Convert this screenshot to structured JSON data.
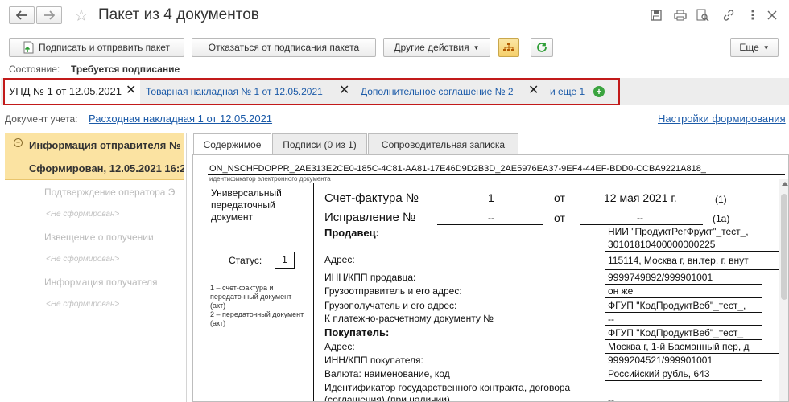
{
  "window": {
    "title": "Пакет из 4 документов"
  },
  "toolbar": {
    "sign_send": "Подписать и отправить пакет",
    "refuse": "Отказаться от подписания пакета",
    "other_actions": "Другие действия",
    "more": "Еще"
  },
  "status": {
    "label": "Состояние:",
    "value": "Требуется подписание"
  },
  "doc_tabs": [
    {
      "label": "УПД № 1 от 12.05.2021"
    },
    {
      "label": "Товарная накладная № 1 от 12.05.2021"
    },
    {
      "label": "Дополнительное соглашение № 2"
    }
  ],
  "doc_tabs_more": "и еще 1",
  "account_doc": {
    "label": "Документ учета:",
    "link": "Расходная накладная 1 от 12.05.2021"
  },
  "settings_link": "Настройки формирования",
  "left_panel": {
    "item1_title": "Информация отправителя №",
    "item1_status": "Сформирован, 12.05.2021 16:2",
    "item2": "Подтверждение оператора Э",
    "item2_status": "<Не сформирован>",
    "item3": "Извещение о получении",
    "item3_status": "<Не сформирован>",
    "item4": "Информация получателя",
    "item4_status": "<Не сформирован>"
  },
  "content_tabs": [
    "Содержимое",
    "Подписи (0 из 1)",
    "Сопроводительная записка"
  ],
  "document": {
    "file_id": "ON_NSCHFDOPPR_2AE313E2CE0-185C-4C81-AA81-17E46D9D2B3D_2AE5976EA37-9EF4-44EF-BDD0-CCBA9221A818_",
    "file_id_caption": "идентификатор электронного документа",
    "doc_type": "Универсальный передаточный документ",
    "status_label": "Статус:",
    "status_value": "1",
    "status_note": "1 – счет-фактура и передаточный документ (акт)\n2 – передаточный документ (акт)",
    "invoice_label": "Счет-фактура №",
    "invoice_number": "1",
    "from": "от",
    "invoice_date": "12 мая 2021 г.",
    "mark1": "(1)",
    "correction_label": "Исправление №",
    "correction_number": "--",
    "correction_date": "--",
    "mark1a": "(1а)",
    "seller_label": "Продавец:",
    "seller_value": "НИИ \"ПродуктРегФрукт\"_тест_,",
    "seller_value2": "30101810400000000225",
    "address_label": "Адрес:",
    "address_value": "115114, Москва г, вн.тер. г. внут",
    "inn_seller_label": "ИНН/КПП продавца:",
    "inn_seller_value": "9999749892/999901001",
    "shipper_label": "Грузоотправитель и его адрес:",
    "shipper_value": "он же",
    "consignee_label": "Грузополучатель и его адрес:",
    "consignee_value": "ФГУП \"КодПродуктВеб\"_тест_,",
    "payment_label": "К платежно-расчетному документу №",
    "payment_value": "--",
    "buyer_label": "Покупатель:",
    "buyer_value": "ФГУП \"КодПродуктВеб\"_тест_",
    "buyer_address_label": "Адрес:",
    "buyer_address_value": "Москва г, 1-й Басманный пер, д",
    "inn_buyer_label": "ИНН/КПП покупателя:",
    "inn_buyer_value": "9999204521/999901001",
    "currency_label": "Валюта: наименование, код",
    "currency_value": "Российский рубль, 643",
    "contract_label": "Идентификатор государственного контракта, договора",
    "contract_label2": "(соглашения) (при наличии)",
    "contract_value": "--"
  }
}
